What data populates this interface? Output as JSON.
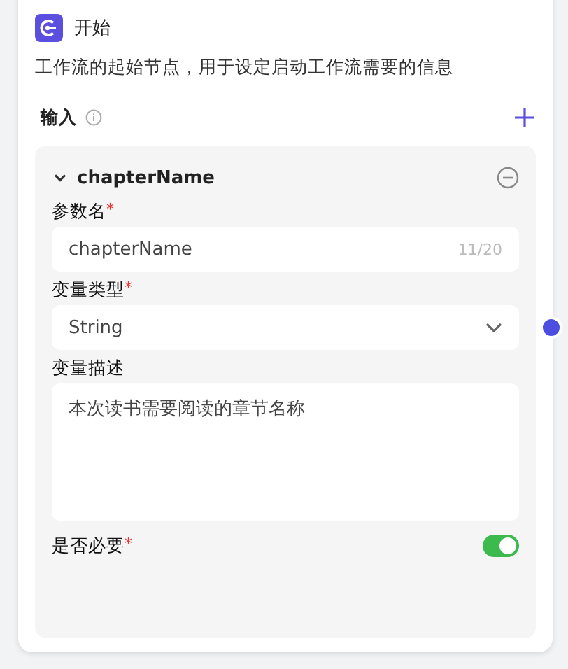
{
  "node": {
    "title": "开始",
    "description": "工作流的起始节点，用于设定启动工作流需要的信息"
  },
  "inputs": {
    "label": "输入",
    "params": [
      {
        "name": "chapterName",
        "expanded": true,
        "fields": [
          {
            "kind": "text",
            "label": "参数名",
            "required_mark": "*",
            "value": "chapterName",
            "count": "11/20"
          },
          {
            "kind": "select",
            "label": "变量类型",
            "required_mark": "*",
            "value": "String"
          },
          {
            "kind": "textarea",
            "label": "变量描述",
            "value": "本次读书需要阅读的章节名称"
          },
          {
            "kind": "switch",
            "label": "是否必要",
            "required_mark": "*",
            "on": true
          }
        ]
      }
    ]
  }
}
